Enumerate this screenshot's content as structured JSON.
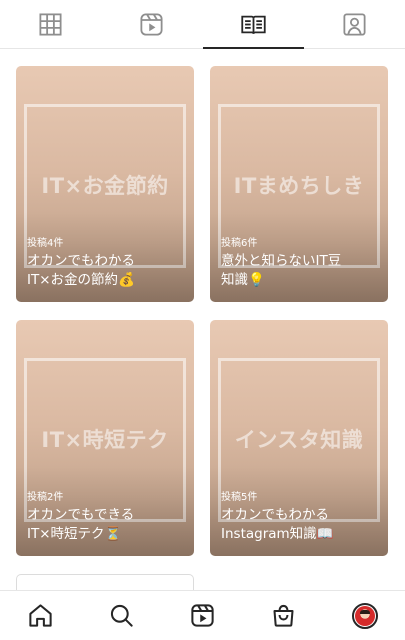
{
  "tabs": [
    {
      "icon": "grid-icon",
      "active": false
    },
    {
      "icon": "reels-icon",
      "active": false
    },
    {
      "icon": "guides-icon",
      "active": true
    },
    {
      "icon": "tagged-icon",
      "active": false
    }
  ],
  "guides": [
    {
      "cover_text": "IT×お金節約",
      "count": "投稿4件",
      "title_line1": "オカンでもわかる",
      "title_line2": "IT×お金の節約💰"
    },
    {
      "cover_text": "ITまめちしき",
      "count": "投稿6件",
      "title_line1": "意外と知らないIT豆",
      "title_line2": "知識💡"
    },
    {
      "cover_text": "IT×時短テク",
      "count": "投稿2件",
      "title_line1": "オカンでもできる",
      "title_line2": "IT×時短テク⏳"
    },
    {
      "cover_text": "インスタ知識",
      "count": "投稿5件",
      "title_line1": "オカンでもわかる",
      "title_line2": "Instagram知識📖"
    }
  ],
  "bottom_nav": [
    {
      "icon": "home-icon"
    },
    {
      "icon": "search-icon"
    },
    {
      "icon": "reels-icon"
    },
    {
      "icon": "shop-icon"
    },
    {
      "icon": "profile-avatar"
    }
  ],
  "colors": {
    "card_top": "#e8c9b3",
    "card_bottom": "#a88a75",
    "icon": "#262626"
  }
}
